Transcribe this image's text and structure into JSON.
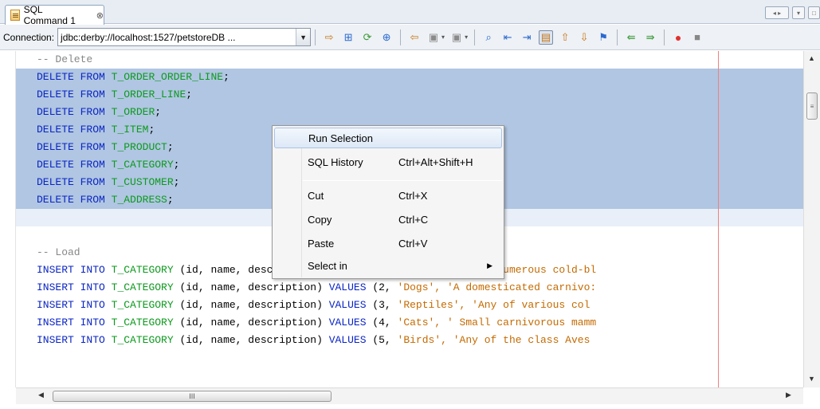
{
  "tab": {
    "label": "SQL Command 1",
    "close": "⊗"
  },
  "toolbar": {
    "connection_label": "Connection:",
    "connection_value": "jdbc:derby://localhost:1527/petstoreDB ..."
  },
  "editor": {
    "lines": [
      {
        "kind": "comment",
        "text": "-- Delete"
      },
      {
        "kind": "delete",
        "kw": "DELETE FROM",
        "table": "T_ORDER_ORDER_LINE",
        "semi": ";"
      },
      {
        "kind": "delete",
        "kw": "DELETE FROM",
        "table": "T_ORDER_LINE",
        "semi": ";"
      },
      {
        "kind": "delete",
        "kw": "DELETE FROM",
        "table": "T_ORDER",
        "semi": ";"
      },
      {
        "kind": "delete",
        "kw": "DELETE FROM",
        "table": "T_ITEM",
        "semi": ";"
      },
      {
        "kind": "delete",
        "kw": "DELETE FROM",
        "table": "T_PRODUCT",
        "semi": ";"
      },
      {
        "kind": "delete",
        "kw": "DELETE FROM",
        "table": "T_CATEGORY",
        "semi": ";"
      },
      {
        "kind": "delete",
        "kw": "DELETE FROM",
        "table": "T_CUSTOMER",
        "semi": ";"
      },
      {
        "kind": "delete",
        "kw": "DELETE FROM",
        "table": "T_ADDRESS",
        "semi": ";"
      },
      {
        "kind": "blank",
        "text": ""
      },
      {
        "kind": "blank",
        "text": ""
      },
      {
        "kind": "comment",
        "text": "-- Load"
      },
      {
        "kind": "insert",
        "kw1": "INSERT INTO",
        "table": "T_CATEGORY",
        "cols": " (id, name, description) ",
        "kw2": "VALUES",
        "num": " (1, ",
        "str": "'Fish', 'Any of numerous cold-bl"
      },
      {
        "kind": "insert",
        "kw1": "INSERT INTO",
        "table": "T_CATEGORY",
        "cols": " (id, name, description) ",
        "kw2": "VALUES",
        "num": " (2, ",
        "str": "'Dogs', 'A domesticated carnivo:"
      },
      {
        "kind": "insert",
        "kw1": "INSERT INTO",
        "table": "T_CATEGORY",
        "cols": " (id, name, description) ",
        "kw2": "VALUES",
        "num": " (3, ",
        "str": "'Reptiles', 'Any of various col"
      },
      {
        "kind": "insert",
        "kw1": "INSERT INTO",
        "table": "T_CATEGORY",
        "cols": " (id, name, description) ",
        "kw2": "VALUES",
        "num": " (4, ",
        "str": "'Cats', ' Small carnivorous mamm"
      },
      {
        "kind": "insert",
        "kw1": "INSERT INTO",
        "table": "T_CATEGORY",
        "cols": " (id, name, description) ",
        "kw2": "VALUES",
        "num": " (5, ",
        "str": "'Birds', 'Any of the class Aves"
      }
    ]
  },
  "context_menu": {
    "items": [
      {
        "label": "Run Selection",
        "shortcut": ""
      },
      {
        "label": "SQL History",
        "shortcut": "Ctrl+Alt+Shift+H"
      },
      {
        "label": "Cut",
        "shortcut": "Ctrl+X"
      },
      {
        "label": "Copy",
        "shortcut": "Ctrl+C"
      },
      {
        "label": "Paste",
        "shortcut": "Ctrl+V"
      },
      {
        "label": "Select in",
        "shortcut": ""
      }
    ]
  },
  "scrollbar": {
    "grip": "III",
    "vgrip": "≡"
  },
  "colors": {
    "keyword": "#0b25c4",
    "identifier": "#0d9a1e",
    "comment": "#878787",
    "string": "#c46a00",
    "selection": "#b0c6e2"
  }
}
